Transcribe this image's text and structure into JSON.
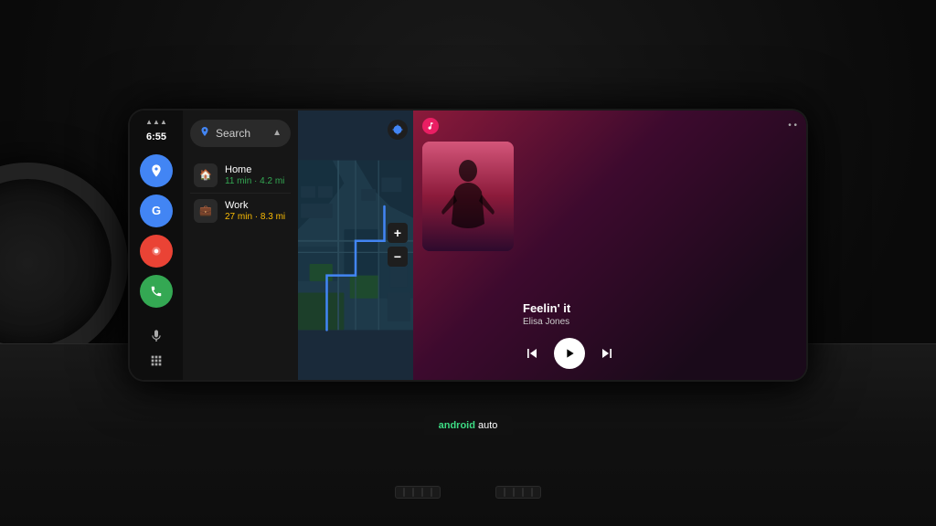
{
  "dashboard": {
    "time": "6:55",
    "signal": "▲▲▲"
  },
  "sidebar": {
    "icons": [
      {
        "name": "maps",
        "symbol": "📍",
        "color": "#4285F4"
      },
      {
        "name": "google",
        "symbol": "G",
        "color": "#4285F4"
      },
      {
        "name": "red-app",
        "symbol": "◉",
        "color": "#EA4335"
      },
      {
        "name": "phone",
        "symbol": "📞",
        "color": "#34A853"
      }
    ]
  },
  "navigation": {
    "search_placeholder": "Search",
    "destinations": [
      {
        "name": "Home",
        "detail": "11 min · 4.2 mi",
        "detail_color": "green",
        "icon": "🏠"
      },
      {
        "name": "Work",
        "detail": "27 min · 8.3 mi",
        "detail_color": "orange",
        "icon": "💼"
      }
    ]
  },
  "music": {
    "track_name": "Feelin' it",
    "artist_name": "Elisa Jones",
    "controls": {
      "prev": "⏮",
      "play": "▶",
      "next": "⏭"
    }
  },
  "branding": {
    "android_text": "android",
    "auto_text": "auto"
  }
}
